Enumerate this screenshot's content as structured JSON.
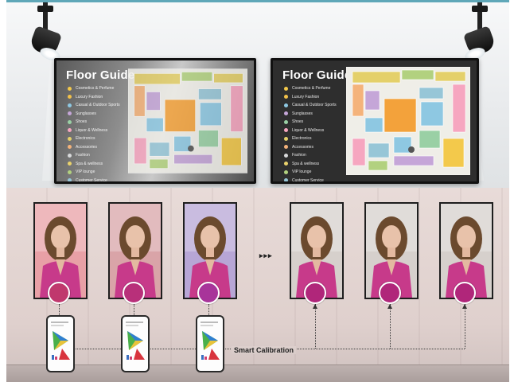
{
  "top_scene": {
    "displays": [
      {
        "id": "left",
        "title": "Floor Guide",
        "legend": [
          {
            "label": "Cosmetics & Perfume",
            "color": "#f3c94b"
          },
          {
            "label": "Luxury Fashion",
            "color": "#f2c14a"
          },
          {
            "label": "Casual & Outdoor Sports",
            "color": "#8ec8e2"
          },
          {
            "label": "Sunglasses",
            "color": "#c5a6d8"
          },
          {
            "label": "Shoes",
            "color": "#9ad0a5"
          },
          {
            "label": "Liquor & Wellness",
            "color": "#f6a6c0"
          },
          {
            "label": "Electronics",
            "color": "#e4d06a"
          },
          {
            "label": "Accessories",
            "color": "#f4b37b"
          },
          {
            "label": "Fashion",
            "color": "#d9dadb"
          },
          {
            "label": "Spa & wellness",
            "color": "#e9d26c"
          },
          {
            "label": "VIP lounge",
            "color": "#b2d17f"
          },
          {
            "label": "Customer Service",
            "color": "#97c6d7"
          }
        ]
      },
      {
        "id": "right",
        "title": "Floor Guide",
        "legend": [
          {
            "label": "Cosmetics & Perfume",
            "color": "#f3c94b"
          },
          {
            "label": "Luxury Fashion",
            "color": "#f2c14a"
          },
          {
            "label": "Casual & Outdoor Sports",
            "color": "#8ec8e2"
          },
          {
            "label": "Sunglasses",
            "color": "#c5a6d8"
          },
          {
            "label": "Shoes",
            "color": "#9ad0a5"
          },
          {
            "label": "Liquor & Wellness",
            "color": "#f6a6c0"
          },
          {
            "label": "Electronics",
            "color": "#e4d06a"
          },
          {
            "label": "Accessories",
            "color": "#f4b37b"
          },
          {
            "label": "Fashion",
            "color": "#d9dadb"
          },
          {
            "label": "Spa & wellness",
            "color": "#e9d26c"
          },
          {
            "label": "VIP lounge",
            "color": "#b2d17f"
          },
          {
            "label": "Customer Service",
            "color": "#97c6d7"
          }
        ]
      }
    ]
  },
  "bottom_scene": {
    "caption": "Smart Calibration",
    "ellipsis": "▸▸▸",
    "portraits": [
      {
        "tint": "#e8a0a6",
        "swatch": "#c0386d"
      },
      {
        "tint": "#d9a4a8",
        "swatch": "#b8307a"
      },
      {
        "tint": "#b7a6d6",
        "swatch": "#a8349a"
      },
      {
        "tint": "#d6d0cc",
        "swatch": "#b0267a"
      },
      {
        "tint": "#d6d0cc",
        "swatch": "#b0267a"
      },
      {
        "tint": "#d6d0cc",
        "swatch": "#b0267a"
      }
    ],
    "colors": {
      "wall": "#e2d4d1",
      "jacket": "#c73a8a",
      "hair": "#6b4a2e"
    }
  }
}
